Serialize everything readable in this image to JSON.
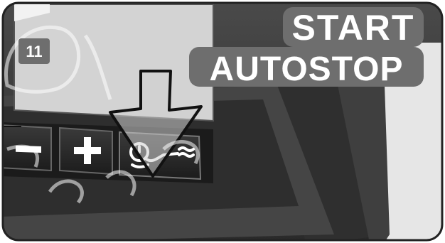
{
  "figure": {
    "step_number": "11",
    "title_line1": "START",
    "title_line2": "AUTOSTOP",
    "keys": {
      "minus_symbol": "−",
      "plus_symbol": "+",
      "autostop_icon": "engine-start-autostop-icon"
    },
    "colors": {
      "background_panel": "#3c3c3c",
      "screen": "#d3d3d3",
      "label_box": "#6e6e6e",
      "label_text": "#ffffff",
      "arrow_fill": "#cfcfcf",
      "arrow_outline": "#111111",
      "watermark": "#ffffff"
    }
  }
}
